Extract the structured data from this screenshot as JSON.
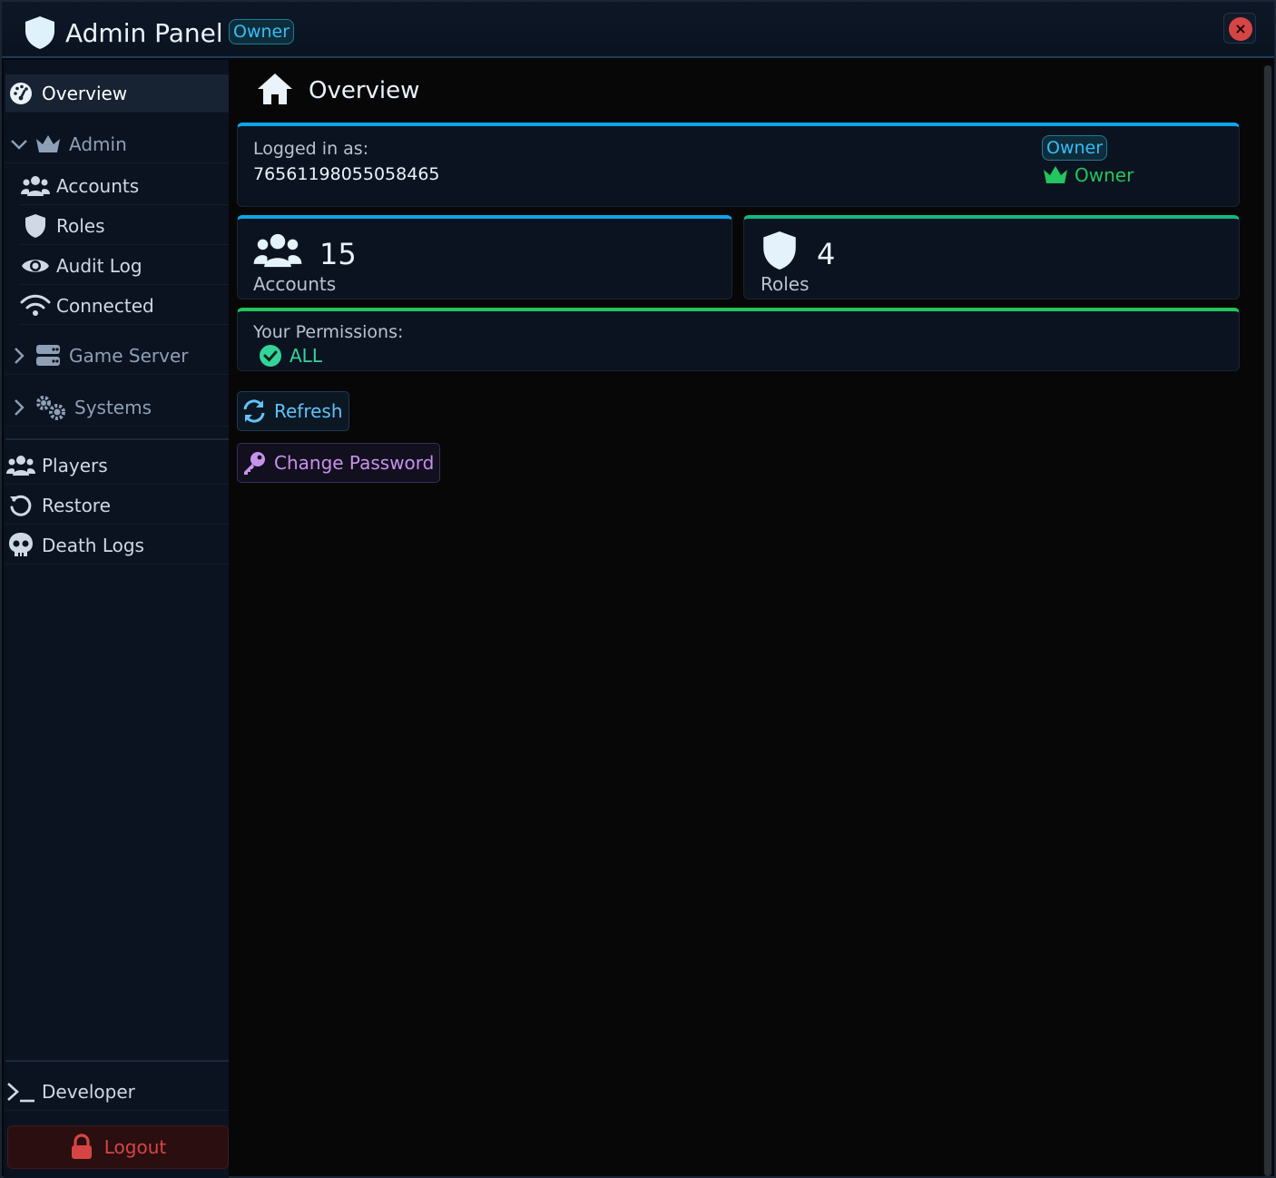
{
  "window": {
    "title": "Admin Panel",
    "role_badge": "Owner",
    "close_symbol": "×"
  },
  "sidebar": {
    "overview": {
      "label": "Overview",
      "icon": "dashboard-icon"
    },
    "admin_group": {
      "label": "Admin",
      "icon": "crown-icon",
      "expanded": true
    },
    "admin_items": [
      {
        "label": "Accounts",
        "icon": "users-icon"
      },
      {
        "label": "Roles",
        "icon": "shield-icon"
      },
      {
        "label": "Audit Log",
        "icon": "eye-icon"
      },
      {
        "label": "Connected",
        "icon": "wifi-icon"
      }
    ],
    "game_server_group": {
      "label": "Game Server",
      "icon": "server-icon",
      "expanded": false
    },
    "systems_group": {
      "label": "Systems",
      "icon": "gears-icon",
      "expanded": false
    },
    "items": [
      {
        "label": "Players",
        "icon": "users-icon"
      },
      {
        "label": "Restore",
        "icon": "restore-icon"
      },
      {
        "label": "Death Logs",
        "icon": "skull-icon"
      }
    ],
    "developer": {
      "label": "Developer",
      "icon": "terminal-icon"
    },
    "logout": {
      "label": "Logout",
      "icon": "lock-icon"
    }
  },
  "main": {
    "title": "Overview",
    "login_card": {
      "label": "Logged in as:",
      "user_id": "76561198055058465",
      "role_badge": "Owner",
      "role_name": "Owner"
    },
    "stats": {
      "accounts": {
        "value": "15",
        "label": "Accounts"
      },
      "roles": {
        "value": "4",
        "label": "Roles"
      }
    },
    "permissions": {
      "label": "Your Permissions:",
      "value": "ALL"
    },
    "buttons": {
      "refresh": "Refresh",
      "change_password": "Change Password"
    }
  },
  "colors": {
    "accent_blue": "#0ea5e9",
    "accent_green": "#22c55e",
    "owner_green": "#22c55e",
    "danger": "#d64545",
    "purple": "#c792ea"
  }
}
